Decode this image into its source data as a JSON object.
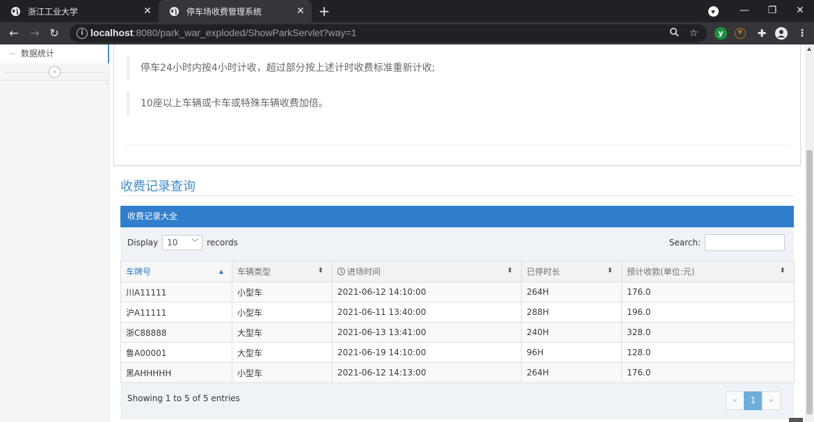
{
  "browser": {
    "tabs": [
      {
        "title": "浙江工业大学",
        "active": false
      },
      {
        "title": "停车场收费管理系统",
        "active": true
      }
    ],
    "url_host": "localhost",
    "url_rest": ":8080/park_war_exploded/ShowParkServlet?way=1"
  },
  "sidebar": {
    "item_label": "数据统计"
  },
  "rules": {
    "line_1": "停车24小时内按4小时计收，超过部分按上述计时收费标准重新计收;",
    "line_2": "10座以上车辆或卡车或特殊车辆收费加倍。"
  },
  "section": {
    "title": "收费记录查询"
  },
  "records_box": {
    "header": "收费记录大全",
    "display_label": "Display",
    "page_size": "10",
    "records_label": "records",
    "search_label": "Search:",
    "columns": [
      "车牌号",
      "车辆类型",
      "进场时间",
      "已停时长",
      "预计收款(单位:元)"
    ],
    "rows": [
      [
        "川A11111",
        "小型车",
        "2021-06-12 14:10:00",
        "264H",
        "176.0"
      ],
      [
        "沪A11111",
        "小型车",
        "2021-06-11 13:40:00",
        "288H",
        "196.0"
      ],
      [
        "浙C88888",
        "大型车",
        "2021-06-13 13:41:00",
        "240H",
        "328.0"
      ],
      [
        "鲁A00001",
        "大型车",
        "2021-06-19 14:10:00",
        "96H",
        "128.0"
      ],
      [
        "黑AHHHHH",
        "小型车",
        "2021-06-12 14:13:00",
        "264H",
        "176.0"
      ]
    ],
    "info": "Showing 1 to 5 of 5 entries",
    "pagination": {
      "prev": "«",
      "current": "1",
      "next": "»"
    }
  }
}
